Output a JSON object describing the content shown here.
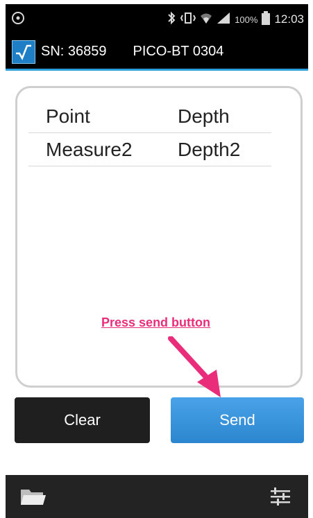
{
  "status_bar": {
    "battery": "100%",
    "time": "12:03",
    "icons": [
      "app-notification-icon",
      "bluetooth-icon",
      "vibrate-icon",
      "wifi-icon",
      "signal-icon",
      "battery-icon"
    ]
  },
  "app_bar": {
    "serial": "SN: 36859",
    "device": "PICO-BT 0304"
  },
  "table": {
    "rows": [
      {
        "point": "Point",
        "depth": "Depth"
      },
      {
        "point": "Measure2",
        "depth": "Depth2"
      }
    ]
  },
  "annotation": {
    "text": "Press send button",
    "color": "#ea2d7a"
  },
  "buttons": {
    "clear_label": "Clear",
    "send_label": "Send"
  },
  "bottom_bar": {
    "left_icon": "folder-icon",
    "right_icon": "settings-sliders-icon"
  },
  "colors": {
    "accent": "#2a9fd8",
    "send_button": "#3a95dc",
    "clear_button": "#1f1f1f"
  }
}
